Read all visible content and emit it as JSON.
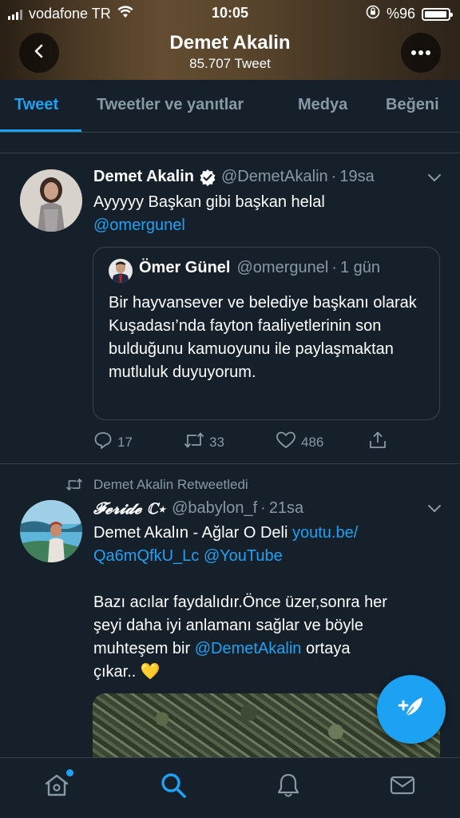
{
  "status_bar": {
    "carrier": "vodafone TR",
    "time": "10:05",
    "battery_percent": "%96",
    "battery_level": 0.96
  },
  "profile": {
    "name": "Demet Akalin",
    "tweet_count": "85.707 Tweet"
  },
  "tabs": [
    {
      "label": "Tweet",
      "active": true
    },
    {
      "label": "Tweetler ve yanıtlar",
      "active": false
    },
    {
      "label": "Medya",
      "active": false
    },
    {
      "label": "Beğeni",
      "active": false
    }
  ],
  "tweets": [
    {
      "author_name": "Demet Akalin",
      "handle": "@DemetAkalin",
      "separator": "·",
      "time": "19sa",
      "text": "Ayyyyy Başkan gibi başkan helal",
      "mention": "@omergunel",
      "quote": {
        "author_name": "Ömer Günel",
        "handle": "@omergunel",
        "separator": "·",
        "time": "1 gün",
        "text": "Bir hayvansever ve belediye başkanı olarak Kuşadası’nda fayton faaliyetlerinin son bulduğunu kamuoyunu ile paylaşmaktan mutluluk duyuyorum."
      },
      "replies": "17",
      "retweets": "33",
      "likes": "486"
    },
    {
      "retweet_note": "Demet Akalin Retweetledi",
      "author_name": "𝓕𝓮𝓻𝓲𝓭𝓮 ℂ⋆",
      "handle": "@babylon_f",
      "separator": "·",
      "time": "21sa",
      "line1_text": "Demet Akalın - Ağlar O Deli ",
      "line1_link": "youtu.be/",
      "line2_link": "Qa6mQfkU_Lc",
      "line2_mention": "@YouTube",
      "para2_line1": "Bazı acılar faydalıdır.Önce üzer,sonra her",
      "para2_line2": "şeyi daha iyi anlamanı sağlar ve böyle",
      "para2_line3_text": "muhteşem bir ",
      "para2_line3_mention": "@DemetAkalin",
      "para2_line3_end": " ortaya",
      "para2_line4": "çıkar.. 💛"
    }
  ],
  "colors": {
    "background": "#15202b",
    "accent": "#1da1f2",
    "muted": "#8899a6",
    "divider": "#38444d"
  },
  "icons": {
    "back": "chevron-left-icon",
    "more": "more-dots-icon",
    "verified": "verified-badge-icon",
    "reply": "reply-icon",
    "retweet": "retweet-icon",
    "like": "heart-icon",
    "share": "share-icon",
    "compose": "compose-tweet-icon",
    "home": "home-icon",
    "search": "search-icon",
    "notifications": "bell-icon",
    "messages": "mail-icon"
  }
}
